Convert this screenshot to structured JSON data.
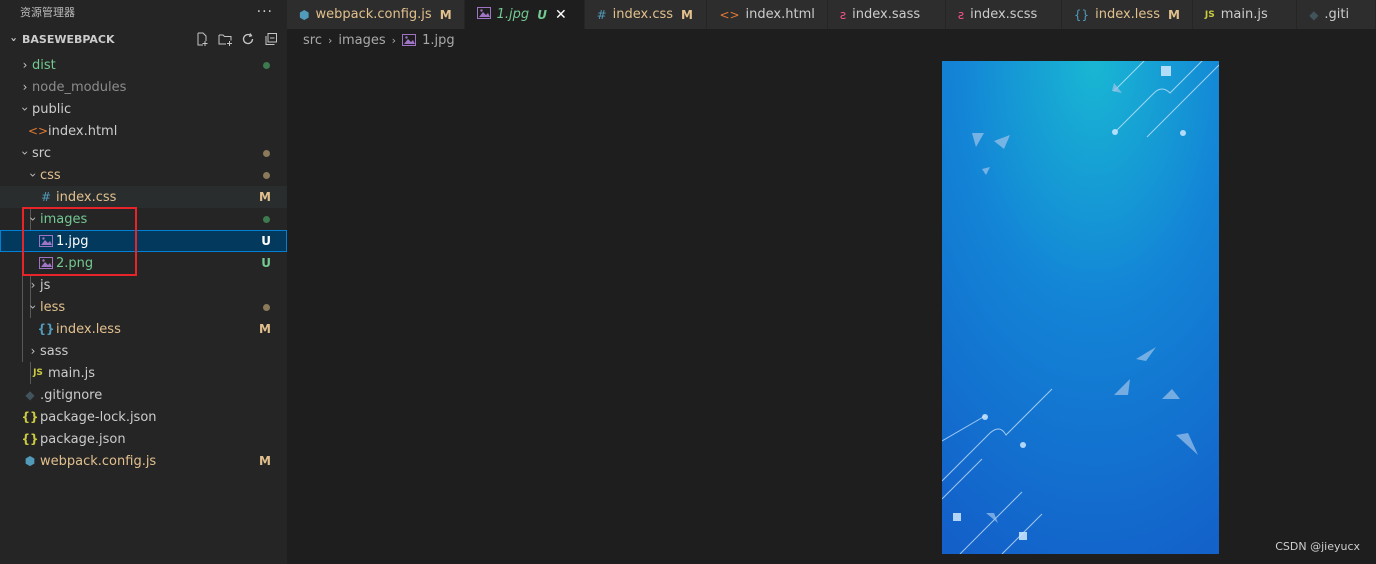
{
  "sidebar": {
    "title": "资源管理器",
    "more": "···",
    "project": "BASEWEBPACK",
    "items": [
      {
        "label": "dist",
        "color": "#73c991",
        "twisty": "›",
        "open": false,
        "indent": 0,
        "icon": "",
        "iconColor": "",
        "marker": "dot",
        "markerColor": "#3d7a4f",
        "badge": ""
      },
      {
        "label": "node_modules",
        "color": "#8c8c8c",
        "twisty": "›",
        "open": false,
        "indent": 0,
        "icon": "",
        "iconColor": "",
        "marker": "",
        "markerColor": "",
        "badge": ""
      },
      {
        "label": "public",
        "color": "#cccccc",
        "twisty": "›",
        "open": true,
        "indent": 0,
        "icon": "",
        "iconColor": "",
        "marker": "",
        "markerColor": "",
        "badge": ""
      },
      {
        "label": "index.html",
        "color": "#cccccc",
        "twisty": "",
        "open": false,
        "indent": 1,
        "icon": "<>",
        "iconColor": "#e37933",
        "marker": "",
        "markerColor": "",
        "badge": ""
      },
      {
        "label": "src",
        "color": "#cccccc",
        "twisty": "›",
        "open": true,
        "indent": 0,
        "icon": "",
        "iconColor": "",
        "marker": "dot",
        "markerColor": "#8a7a5a",
        "badge": ""
      },
      {
        "label": "css",
        "color": "#e2c08d",
        "twisty": "›",
        "open": true,
        "indent": 1,
        "icon": "",
        "iconColor": "",
        "marker": "dot",
        "markerColor": "#8a7a5a",
        "badge": ""
      },
      {
        "label": "index.css",
        "color": "#e2c08d",
        "twisty": "",
        "open": false,
        "indent": 2,
        "icon": "#",
        "iconColor": "#519aba",
        "marker": "",
        "markerColor": "",
        "badge": "M",
        "badgeColor": "#e2c08d",
        "hl": true
      },
      {
        "label": "images",
        "color": "#73c991",
        "twisty": "›",
        "open": true,
        "indent": 1,
        "icon": "",
        "iconColor": "",
        "marker": "dot",
        "markerColor": "#3d7a4f",
        "badge": ""
      },
      {
        "label": "1.jpg",
        "color": "#ffffff",
        "twisty": "",
        "open": false,
        "indent": 2,
        "icon": "img",
        "iconColor": "#a074c4",
        "marker": "",
        "markerColor": "",
        "badge": "U",
        "badgeColor": "#ffffff",
        "selected": true
      },
      {
        "label": "2.png",
        "color": "#73c991",
        "twisty": "",
        "open": false,
        "indent": 2,
        "icon": "img",
        "iconColor": "#a074c4",
        "marker": "",
        "markerColor": "",
        "badge": "U",
        "badgeColor": "#73c991"
      },
      {
        "label": "js",
        "color": "#cccccc",
        "twisty": "›",
        "open": false,
        "indent": 1,
        "icon": "",
        "iconColor": "",
        "marker": "",
        "markerColor": "",
        "badge": ""
      },
      {
        "label": "less",
        "color": "#e2c08d",
        "twisty": "›",
        "open": true,
        "indent": 1,
        "icon": "",
        "iconColor": "",
        "marker": "dot",
        "markerColor": "#8a7a5a",
        "badge": ""
      },
      {
        "label": "index.less",
        "color": "#e2c08d",
        "twisty": "",
        "open": false,
        "indent": 2,
        "icon": "{}",
        "iconColor": "#519aba",
        "marker": "",
        "markerColor": "",
        "badge": "M",
        "badgeColor": "#e2c08d"
      },
      {
        "label": "sass",
        "color": "#cccccc",
        "twisty": "›",
        "open": false,
        "indent": 1,
        "icon": "",
        "iconColor": "",
        "marker": "",
        "markerColor": "",
        "badge": ""
      },
      {
        "label": "main.js",
        "color": "#cccccc",
        "twisty": "",
        "open": false,
        "indent": 1,
        "icon": "JS",
        "iconColor": "#cbcb41",
        "marker": "",
        "markerColor": "",
        "badge": ""
      },
      {
        "label": ".gitignore",
        "color": "#cccccc",
        "twisty": "",
        "open": false,
        "indent": 0,
        "icon": "◆",
        "iconColor": "#41535b",
        "marker": "",
        "markerColor": "",
        "badge": ""
      },
      {
        "label": "package-lock.json",
        "color": "#cccccc",
        "twisty": "",
        "open": false,
        "indent": 0,
        "icon": "{}",
        "iconColor": "#cbcb41",
        "marker": "",
        "markerColor": "",
        "badge": ""
      },
      {
        "label": "package.json",
        "color": "#cccccc",
        "twisty": "",
        "open": false,
        "indent": 0,
        "icon": "{}",
        "iconColor": "#cbcb41",
        "marker": "",
        "markerColor": "",
        "badge": ""
      },
      {
        "label": "webpack.config.js",
        "color": "#e2c08d",
        "twisty": "",
        "open": false,
        "indent": 0,
        "icon": "⬢",
        "iconColor": "#519aba",
        "marker": "",
        "markerColor": "",
        "badge": "M",
        "badgeColor": "#e2c08d"
      }
    ]
  },
  "tabs": [
    {
      "label": "webpack.config.js",
      "color": "#e2c08d",
      "icon": "⬢",
      "iconColor": "#519aba",
      "status": "M",
      "statusColor": "#e2c08d"
    },
    {
      "label": "1.jpg",
      "color": "#73c991",
      "icon": "img",
      "iconColor": "#a074c4",
      "status": "U",
      "statusColor": "#73c991",
      "active": true,
      "italic": true,
      "close": "✕"
    },
    {
      "label": "index.css",
      "color": "#e2c08d",
      "icon": "#",
      "iconColor": "#519aba",
      "status": "M",
      "statusColor": "#e2c08d"
    },
    {
      "label": "index.html",
      "color": "#cccccc",
      "icon": "<>",
      "iconColor": "#e37933",
      "status": "",
      "statusColor": ""
    },
    {
      "label": "index.sass",
      "color": "#cccccc",
      "icon": "ƨ",
      "iconColor": "#f55385",
      "status": "",
      "statusColor": ""
    },
    {
      "label": "index.scss",
      "color": "#cccccc",
      "icon": "ƨ",
      "iconColor": "#f55385",
      "status": "",
      "statusColor": ""
    },
    {
      "label": "index.less",
      "color": "#e2c08d",
      "icon": "{}",
      "iconColor": "#519aba",
      "status": "M",
      "statusColor": "#e2c08d"
    },
    {
      "label": "main.js",
      "color": "#cccccc",
      "icon": "JS",
      "iconColor": "#cbcb41",
      "status": "",
      "statusColor": ""
    },
    {
      "label": ".giti",
      "color": "#cccccc",
      "icon": "◆",
      "iconColor": "#41535b",
      "status": "",
      "statusColor": ""
    }
  ],
  "breadcrumb": {
    "parts": [
      "src",
      "images"
    ],
    "file": "1.jpg",
    "sep": "›"
  },
  "watermark": "CSDN @jieyucx"
}
